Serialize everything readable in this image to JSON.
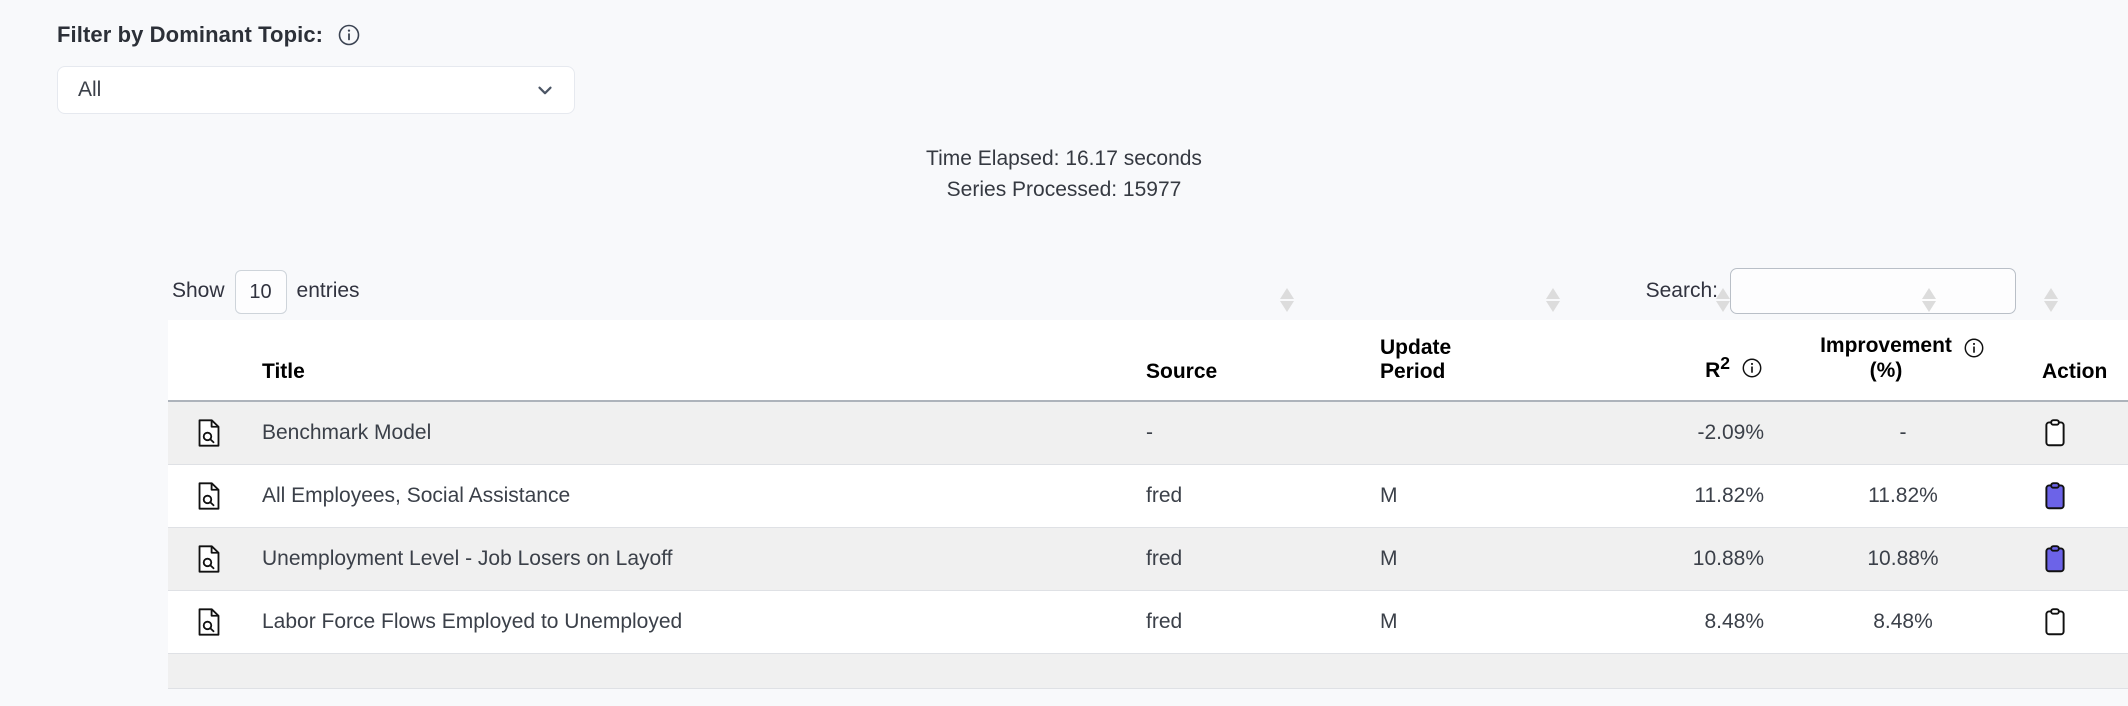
{
  "filter": {
    "label": "Filter by Dominant Topic:",
    "info_icon": "info-circle-icon",
    "select_value": "All",
    "chevron_icon": "chevron-down-icon"
  },
  "status": {
    "time_elapsed": "Time Elapsed: 16.17 seconds",
    "series_processed": "Series Processed: 15977"
  },
  "table_controls": {
    "show_label": "Show",
    "entries_value": "10",
    "entries_label": "entries",
    "search_label": "Search:",
    "search_value": "",
    "search_placeholder": ""
  },
  "table": {
    "columns": [
      {
        "key": "icon",
        "label": ""
      },
      {
        "key": "title",
        "label": "Title"
      },
      {
        "key": "source",
        "label": "Source"
      },
      {
        "key": "period",
        "label": "Update Period",
        "line1": "Update",
        "line2": "Period"
      },
      {
        "key": "r2",
        "label": "R2",
        "base": "R",
        "sup": "2",
        "info_icon": "info-circle-icon"
      },
      {
        "key": "impr",
        "label": "Improvement (%)",
        "line1": "Improvement",
        "line2": "(%)",
        "info_icon": "info-circle-icon"
      },
      {
        "key": "action",
        "label": "Action"
      }
    ],
    "rows": [
      {
        "icon": "document-search-icon",
        "title": "Benchmark Model",
        "source": "-",
        "period": "",
        "r2": "-2.09%",
        "improvement": "-",
        "action_icon": "clipboard-icon",
        "action_filled": false
      },
      {
        "icon": "document-search-icon",
        "title": "All Employees, Social Assistance",
        "source": "fred",
        "period": "M",
        "r2": "11.82%",
        "improvement": "11.82%",
        "action_icon": "clipboard-icon",
        "action_filled": true
      },
      {
        "icon": "document-search-icon",
        "title": "Unemployment Level - Job Losers on Layoff",
        "source": "fred",
        "period": "M",
        "r2": "10.88%",
        "improvement": "10.88%",
        "action_icon": "clipboard-icon",
        "action_filled": true
      },
      {
        "icon": "document-search-icon",
        "title": "Labor Force Flows Employed to Unemployed",
        "source": "fred",
        "period": "M",
        "r2": "8.48%",
        "improvement": "8.48%",
        "action_icon": "clipboard-icon",
        "action_filled": false
      }
    ]
  },
  "colors": {
    "page_background": "#f8f9fb",
    "table_background": "#ffffff",
    "row_stripe": "#f0f0f0",
    "accent_clipboard": "#6c63e8",
    "text": "#31333f",
    "sort_arrow": "#dcdcdc"
  }
}
